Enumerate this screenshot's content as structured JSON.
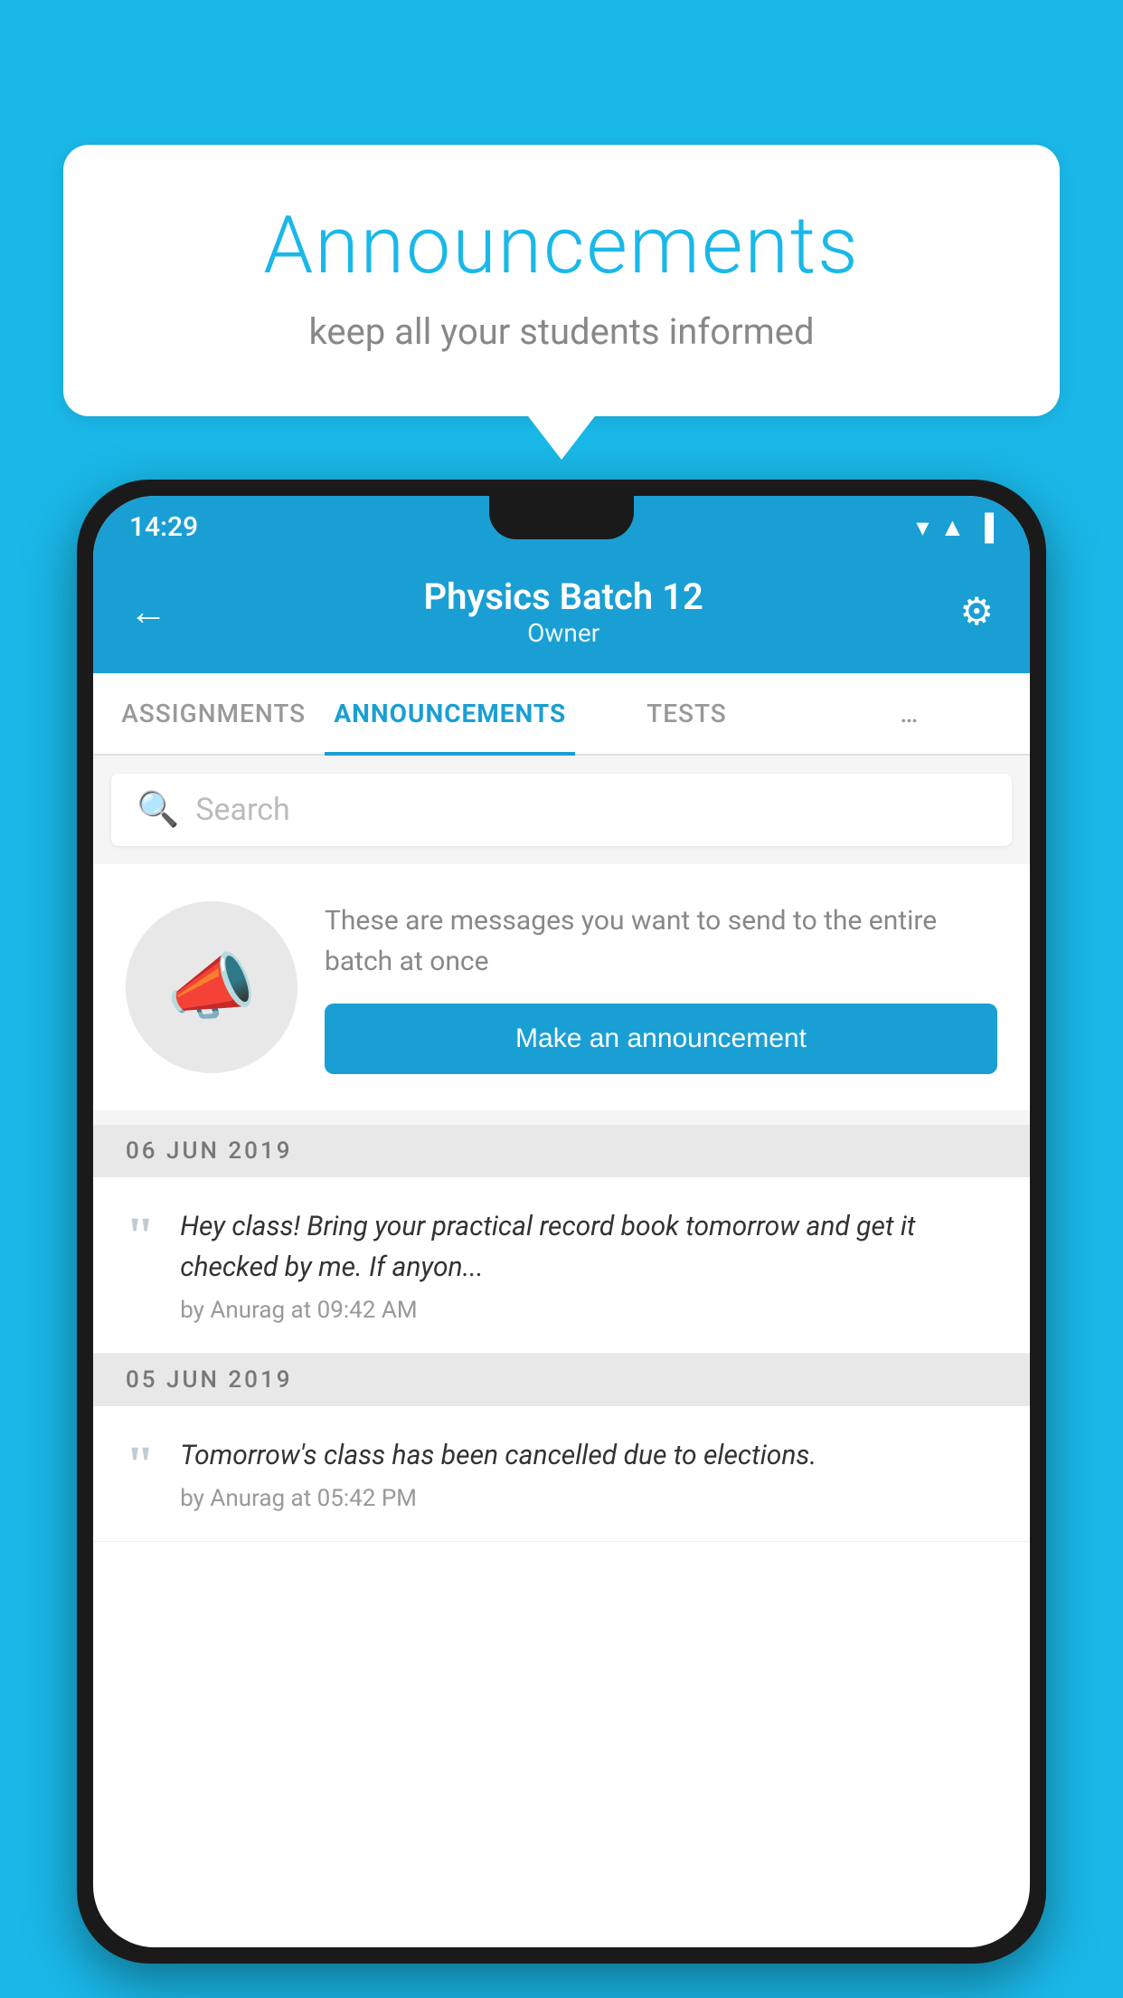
{
  "background_color": "#1ab8e8",
  "speech_bubble": {
    "title": "Announcements",
    "subtitle": "keep all your students informed"
  },
  "phone": {
    "status_bar": {
      "time": "14:29",
      "icons": [
        "▼",
        "▲",
        "▐"
      ]
    },
    "header": {
      "back_label": "←",
      "title": "Physics Batch 12",
      "subtitle": "Owner",
      "gear_label": "⚙"
    },
    "tabs": [
      {
        "label": "ASSIGNMENTS",
        "active": false
      },
      {
        "label": "ANNOUNCEMENTS",
        "active": true
      },
      {
        "label": "TESTS",
        "active": false
      },
      {
        "label": "…",
        "active": false
      }
    ],
    "search": {
      "placeholder": "Search"
    },
    "promo": {
      "description": "These are messages you want to send to the entire batch at once",
      "button_label": "Make an announcement"
    },
    "announcements": [
      {
        "date": "06  JUN  2019",
        "text": "Hey class! Bring your practical record book tomorrow and get it checked by me. If anyon...",
        "meta": "by Anurag at 09:42 AM"
      },
      {
        "date": "05  JUN  2019",
        "text": "Tomorrow's class has been cancelled due to elections.",
        "meta": "by Anurag at 05:42 PM"
      }
    ]
  }
}
